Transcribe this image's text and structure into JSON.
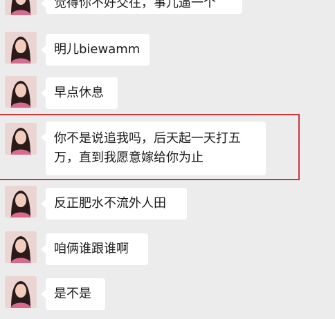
{
  "messages": [
    {
      "text": "觉得你不好交往，事儿逼一个"
    },
    {
      "text": "明儿biewamm"
    },
    {
      "text": "早点休息"
    },
    {
      "lines": [
        "你不是说追我吗，后天起一天打五",
        "万，直到我愿意嫁给你为止"
      ]
    },
    {
      "text": "反正肥水不流外人田"
    },
    {
      "text": "咱俩谁跟谁啊"
    },
    {
      "text": "是不是"
    }
  ],
  "colors": {
    "background": "#ececec",
    "bubble": "#ffffff",
    "highlight_border": "#c9373a"
  }
}
